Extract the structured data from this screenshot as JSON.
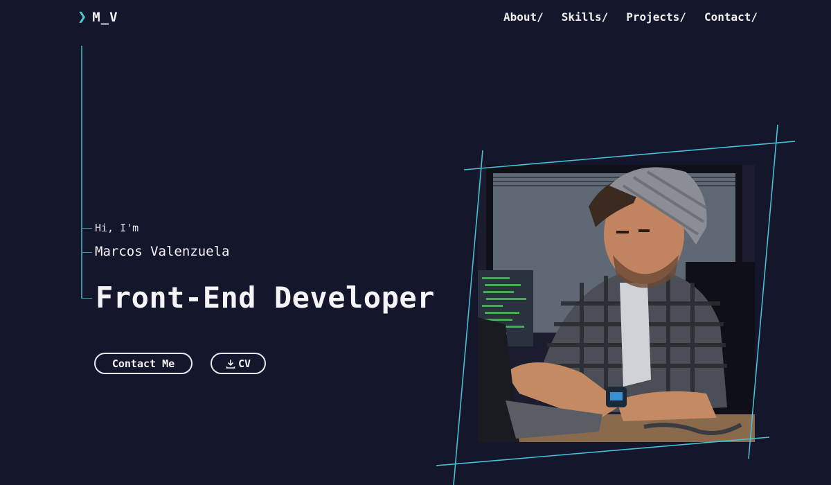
{
  "logo": {
    "icon": "chevron-right-icon",
    "text": "M_V"
  },
  "nav": {
    "items": [
      "About/",
      "Skills/",
      "Projects/",
      "Contact/"
    ]
  },
  "hero": {
    "greeting": "Hi, I'm",
    "name": "Marcos Valenzuela",
    "role": "Front-End Developer",
    "contact_label": "Contact Me",
    "cv_label": "CV",
    "cv_icon": "download-icon"
  },
  "colors": {
    "background": "#14162b",
    "accent": "#4ecad3",
    "text": "#f4f4f6"
  }
}
